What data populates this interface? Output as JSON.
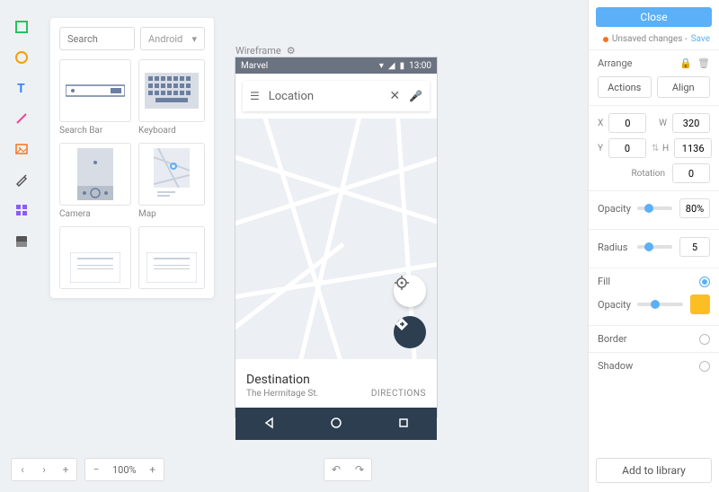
{
  "tools": [
    "square",
    "circle",
    "text",
    "line",
    "image",
    "pen",
    "grid",
    "screen"
  ],
  "components": {
    "search_placeholder": "Search",
    "platform": "Android",
    "items": [
      {
        "label": "Search Bar"
      },
      {
        "label": "Keyboard"
      },
      {
        "label": "Camera"
      },
      {
        "label": "Map"
      },
      {
        "label": ""
      },
      {
        "label": ""
      }
    ]
  },
  "canvas": {
    "title": "Wireframe",
    "statusbar_title": "Marvel",
    "statusbar_time": "13:00",
    "search_placeholder": "Location",
    "destination_title": "Destination",
    "destination_sub": "The Hermitage St.",
    "directions_label": "DIRECTIONS"
  },
  "panel": {
    "close": "Close",
    "unsaved": "Unsaved changes -",
    "save": "Save",
    "arrange": "Arrange",
    "actions": "Actions",
    "align": "Align",
    "x": "0",
    "y": "0",
    "w": "320",
    "h": "1136",
    "rotation_label": "Rotation",
    "rotation": "0",
    "opacity_label": "Opacity",
    "opacity": "80%",
    "radius_label": "Radius",
    "radius": "5",
    "fill_label": "Fill",
    "fill_opacity_label": "Opacity",
    "fill_color": "#fbbf24",
    "border_label": "Border",
    "shadow_label": "Shadow",
    "add_to_library": "Add to library"
  },
  "zoom": "100%"
}
